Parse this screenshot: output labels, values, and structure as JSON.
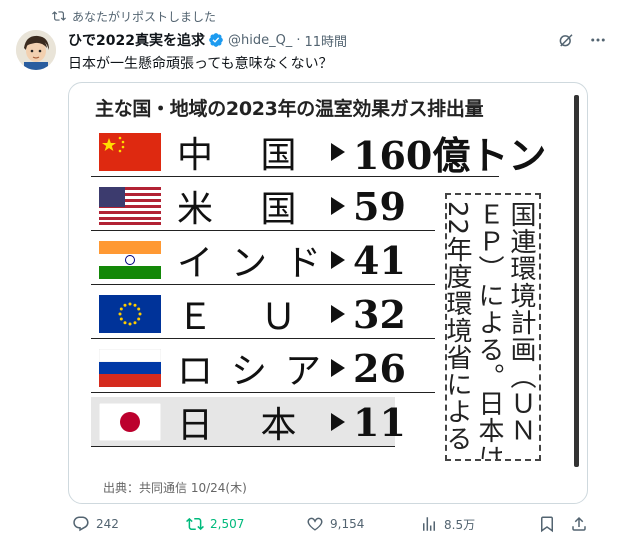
{
  "repost_banner": {
    "text": "あなたがリポストしました"
  },
  "author": {
    "name": "ひで2022真実を追求",
    "handle": "@hide_Q_",
    "time": "11時間"
  },
  "tweet_text": "日本が一生懸命頑張っても意味なくない？",
  "infographic": {
    "title": "主な国・地域の2023年の温室効果ガス排出量",
    "rows": [
      {
        "country": "中 国",
        "value": "160億トン",
        "flag": "china-flag"
      },
      {
        "country": "米 国",
        "value": "59",
        "flag": "usa-flag"
      },
      {
        "country": "インド",
        "value": "41",
        "flag": "india-flag"
      },
      {
        "country": "Ｅ Ｕ",
        "value": "32",
        "flag": "eu-flag"
      },
      {
        "country": "ロシア",
        "value": "26",
        "flag": "russia-flag"
      },
      {
        "country": "日 本",
        "value": "11",
        "flag": "japan-flag"
      }
    ],
    "note_columns": [
      "国連環境計画（ＵＮ",
      "ＥＰ）による。日本は",
      "22年度環境省による"
    ],
    "source": "出典：共同通信 10/24(木)"
  },
  "actions": {
    "replies": "242",
    "reposts": "2,507",
    "likes": "9,154",
    "views": "8.5万"
  },
  "colors": {
    "repost_active": "#00ba7c",
    "verified": "#1d9bf0",
    "muted_text": "#536471"
  }
}
